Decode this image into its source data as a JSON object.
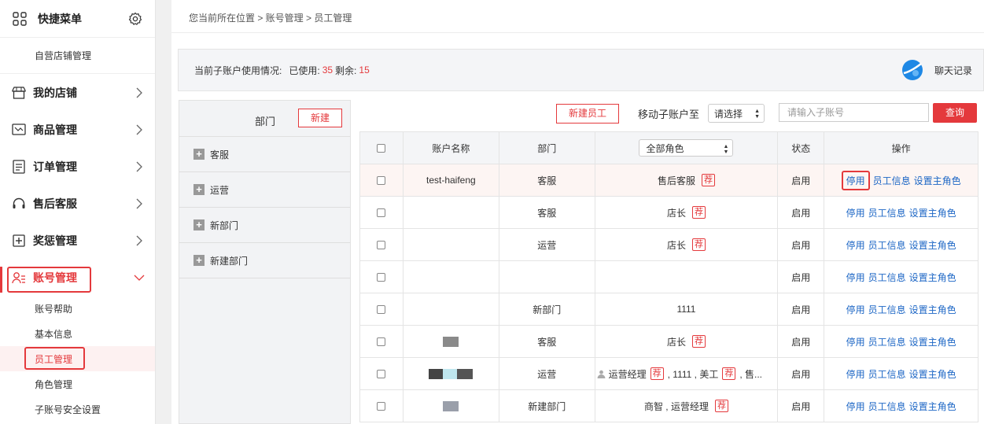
{
  "sidebar": {
    "title": "快捷菜单",
    "shortcut": "自营店铺管理",
    "items": [
      {
        "label": "我的店铺"
      },
      {
        "label": "商品管理"
      },
      {
        "label": "订单管理"
      },
      {
        "label": "售后客服"
      },
      {
        "label": "奖惩管理"
      },
      {
        "label": "账号管理"
      }
    ],
    "subitems": [
      "账号帮助",
      "基本信息",
      "员工管理",
      "角色管理",
      "子账号安全设置"
    ]
  },
  "breadcrumb": "您当前所在位置 > 账号管理 > 员工管理",
  "usage": {
    "label": "当前子账户使用情况:",
    "used_label": "已使用:",
    "used": "35",
    "remaining_label": "剩余:",
    "remaining": "15",
    "chat_label": "聊天记录"
  },
  "dept": {
    "title": "部门",
    "new_button": "新建",
    "items": [
      "客服",
      "运营",
      "新部门",
      "新建部门"
    ]
  },
  "toolbar": {
    "new_employee": "新建员工",
    "move_label": "移动子账户至",
    "move_select": "请选择",
    "search_placeholder": "请输入子账号",
    "search_button": "查询"
  },
  "table": {
    "headers": {
      "name": "账户名称",
      "dept": "部门",
      "role_filter": "全部角色",
      "status": "状态",
      "ops": "操作"
    },
    "tag": "荐",
    "op_disable": "停用",
    "op_info": "员工信息",
    "op_set_role": "设置主角色",
    "rows": [
      {
        "name": "test-haifeng",
        "dept": "客服",
        "role": "售后客服",
        "status": "启用"
      },
      {
        "name": "",
        "dept": "客服",
        "role": "店长",
        "status": "启用"
      },
      {
        "name": "",
        "dept": "运营",
        "role": "店长",
        "status": "启用"
      },
      {
        "name": "",
        "dept": "",
        "role": "",
        "status": "启用"
      },
      {
        "name": "",
        "dept": "新部门",
        "role": "1111",
        "status": "启用"
      },
      {
        "name": "",
        "dept": "客服",
        "role": "店长",
        "status": "启用"
      },
      {
        "name": "",
        "dept": "运营",
        "role_a": "运营经理",
        "role_b": ", 1111 , 美工",
        "role_c": ", 售...",
        "status": "启用"
      },
      {
        "name": "",
        "dept": "新建部门",
        "role": "商智 , 运营经理",
        "status": "启用"
      }
    ]
  }
}
